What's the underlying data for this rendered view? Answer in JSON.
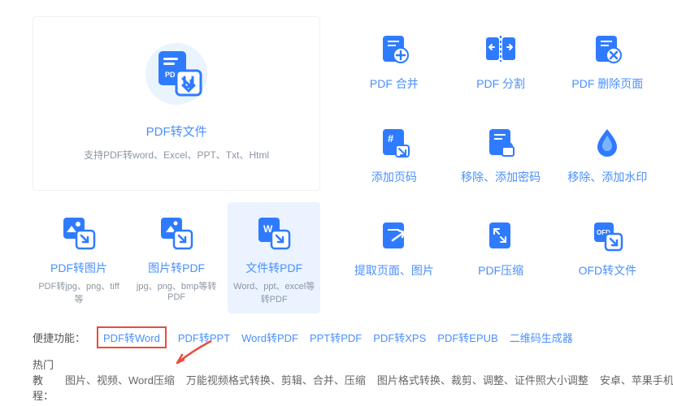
{
  "bigCard": {
    "title": "PDF转文件",
    "subtitle": "支持PDF转word、Excel、PPT、Txt、Html"
  },
  "smallCards": [
    {
      "title": "PDF转图片",
      "subtitle": "PDF转jpg、png、tiff等"
    },
    {
      "title": "图片转PDF",
      "subtitle": "jpg、png、bmp等转PDF"
    },
    {
      "title": "文件转PDF",
      "subtitle": "Word、ppt、excel等转PDF"
    }
  ],
  "rightGrid": [
    {
      "label": "PDF 合并"
    },
    {
      "label": "PDF 分割"
    },
    {
      "label": "PDF 删除页面"
    },
    {
      "label": "添加页码"
    },
    {
      "label": "移除、添加密码"
    },
    {
      "label": "移除、添加水印"
    },
    {
      "label": "提取页面、图片"
    },
    {
      "label": "PDF压缩"
    },
    {
      "label": "OFD转文件"
    }
  ],
  "shortcuts": {
    "label": "便捷功能：",
    "items": [
      "PDF转Word",
      "PDF转PPT",
      "Word转PDF",
      "PPT转PDF",
      "PDF转XPS",
      "PDF转EPUB",
      "二维码生成器"
    ]
  },
  "tutorials": {
    "label": "热门教程：",
    "items": [
      "图片、视频、Word压缩",
      "万能视频格式转换、剪辑、合并、压缩",
      "图片格式转换、裁剪、调整、证件照大小调整",
      "安卓、苹果手机投屏到"
    ]
  }
}
